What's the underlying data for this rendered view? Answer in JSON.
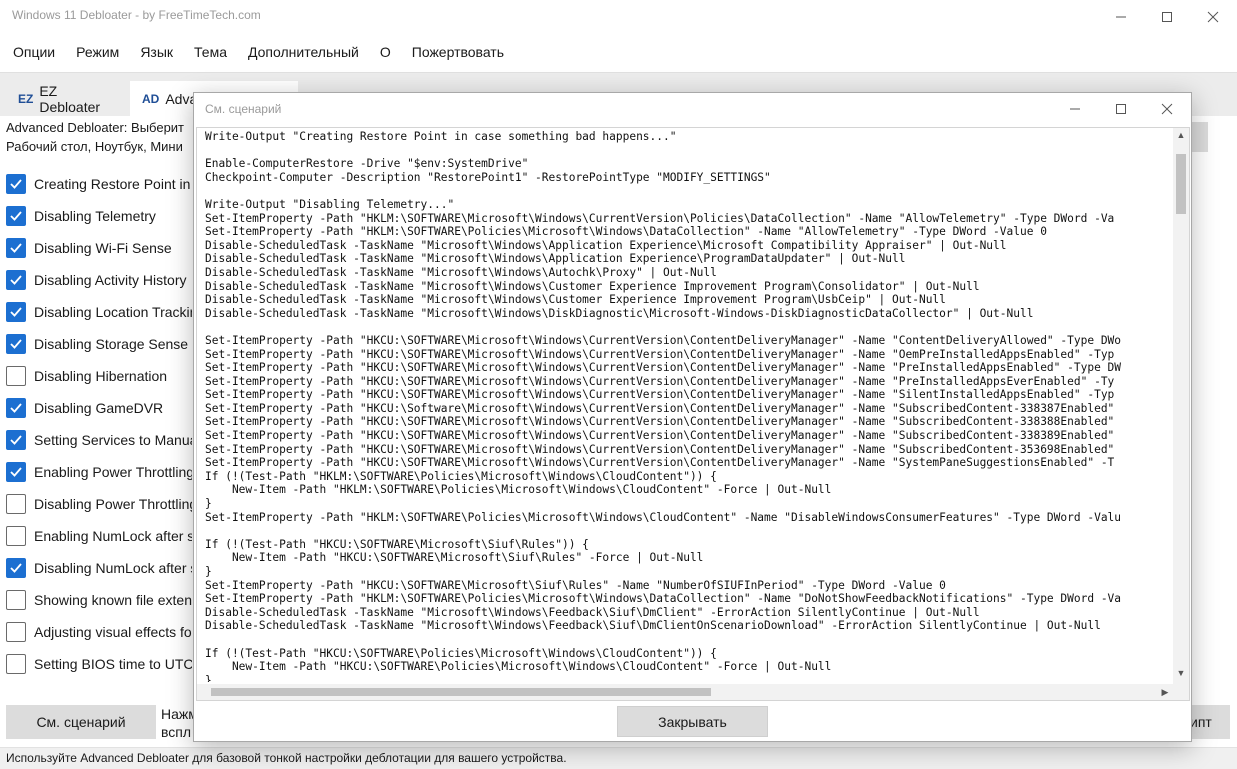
{
  "window": {
    "title": "Windows 11 Debloater - by FreeTimeTech.com"
  },
  "menu": [
    {
      "label": "Опции"
    },
    {
      "label": "Режим"
    },
    {
      "label": "Язык"
    },
    {
      "label": "Тема"
    },
    {
      "label": "Дополнительный"
    },
    {
      "label": "О"
    },
    {
      "label": "Пожертвовать"
    }
  ],
  "tabs": {
    "ez": {
      "abbr": "EZ",
      "label": "EZ Debloater"
    },
    "advanced": {
      "abbr": "AD",
      "label": "Adva"
    }
  },
  "description": {
    "line1": "Advanced Debloater: Выберит",
    "line2": "Рабочий стол, Ноутбук, Мини"
  },
  "options": [
    {
      "label": "Creating Restore Point in c",
      "checked": true
    },
    {
      "label": "Disabling Telemetry",
      "checked": true
    },
    {
      "label": "Disabling Wi-Fi Sense",
      "checked": true
    },
    {
      "label": "Disabling Activity History",
      "checked": true
    },
    {
      "label": "Disabling Location Tracking",
      "checked": true
    },
    {
      "label": "Disabling Storage Sense",
      "checked": true
    },
    {
      "label": "Disabling Hibernation",
      "checked": false
    },
    {
      "label": "Disabling GameDVR",
      "checked": true
    },
    {
      "label": "Setting Services to Manual",
      "checked": true
    },
    {
      "label": "Enabling Power Throttling",
      "checked": true
    },
    {
      "label": "Disabling Power Throttling",
      "checked": false
    },
    {
      "label": "Enabling NumLock after s",
      "checked": false
    },
    {
      "label": "Disabling NumLock after s",
      "checked": true
    },
    {
      "label": "Showing known file exten",
      "checked": false
    },
    {
      "label": "Adjusting visual effects fo",
      "checked": false
    },
    {
      "label": "Setting BIOS time to UTC",
      "checked": false
    }
  ],
  "bottom": {
    "view_script": "См. сценарий",
    "hint_line1": "Нажм",
    "hint_line2": "вспл",
    "right_button": "ипт"
  },
  "status": "Используйте Advanced Debloater для базовой тонкой настройки деблотации для вашего устройства.",
  "dialog": {
    "title": "См. сценарий",
    "close_button": "Закрывать",
    "script": "Write-Output \"Creating Restore Point in case something bad happens...\"\n\nEnable-ComputerRestore -Drive \"$env:SystemDrive\"\nCheckpoint-Computer -Description \"RestorePoint1\" -RestorePointType \"MODIFY_SETTINGS\"\n\nWrite-Output \"Disabling Telemetry...\"\nSet-ItemProperty -Path \"HKLM:\\SOFTWARE\\Microsoft\\Windows\\CurrentVersion\\Policies\\DataCollection\" -Name \"AllowTelemetry\" -Type DWord -Va\nSet-ItemProperty -Path \"HKLM:\\SOFTWARE\\Policies\\Microsoft\\Windows\\DataCollection\" -Name \"AllowTelemetry\" -Type DWord -Value 0\nDisable-ScheduledTask -TaskName \"Microsoft\\Windows\\Application Experience\\Microsoft Compatibility Appraiser\" | Out-Null\nDisable-ScheduledTask -TaskName \"Microsoft\\Windows\\Application Experience\\ProgramDataUpdater\" | Out-Null\nDisable-ScheduledTask -TaskName \"Microsoft\\Windows\\Autochk\\Proxy\" | Out-Null\nDisable-ScheduledTask -TaskName \"Microsoft\\Windows\\Customer Experience Improvement Program\\Consolidator\" | Out-Null\nDisable-ScheduledTask -TaskName \"Microsoft\\Windows\\Customer Experience Improvement Program\\UsbCeip\" | Out-Null\nDisable-ScheduledTask -TaskName \"Microsoft\\Windows\\DiskDiagnostic\\Microsoft-Windows-DiskDiagnosticDataCollector\" | Out-Null\n\nSet-ItemProperty -Path \"HKCU:\\SOFTWARE\\Microsoft\\Windows\\CurrentVersion\\ContentDeliveryManager\" -Name \"ContentDeliveryAllowed\" -Type DWo\nSet-ItemProperty -Path \"HKCU:\\SOFTWARE\\Microsoft\\Windows\\CurrentVersion\\ContentDeliveryManager\" -Name \"OemPreInstalledAppsEnabled\" -Typ\nSet-ItemProperty -Path \"HKCU:\\SOFTWARE\\Microsoft\\Windows\\CurrentVersion\\ContentDeliveryManager\" -Name \"PreInstalledAppsEnabled\" -Type DW\nSet-ItemProperty -Path \"HKCU:\\SOFTWARE\\Microsoft\\Windows\\CurrentVersion\\ContentDeliveryManager\" -Name \"PreInstalledAppsEverEnabled\" -Ty\nSet-ItemProperty -Path \"HKCU:\\SOFTWARE\\Microsoft\\Windows\\CurrentVersion\\ContentDeliveryManager\" -Name \"SilentInstalledAppsEnabled\" -Typ\nSet-ItemProperty -Path \"HKCU:\\Software\\Microsoft\\Windows\\CurrentVersion\\ContentDeliveryManager\" -Name \"SubscribedContent-338387Enabled\" \nSet-ItemProperty -Path \"HKCU:\\SOFTWARE\\Microsoft\\Windows\\CurrentVersion\\ContentDeliveryManager\" -Name \"SubscribedContent-338388Enabled\" \nSet-ItemProperty -Path \"HKCU:\\SOFTWARE\\Microsoft\\Windows\\CurrentVersion\\ContentDeliveryManager\" -Name \"SubscribedContent-338389Enabled\" \nSet-ItemProperty -Path \"HKCU:\\SOFTWARE\\Microsoft\\Windows\\CurrentVersion\\ContentDeliveryManager\" -Name \"SubscribedContent-353698Enabled\" \nSet-ItemProperty -Path \"HKCU:\\SOFTWARE\\Microsoft\\Windows\\CurrentVersion\\ContentDeliveryManager\" -Name \"SystemPaneSuggestionsEnabled\" -T\nIf (!(Test-Path \"HKLM:\\SOFTWARE\\Policies\\Microsoft\\Windows\\CloudContent\")) {\n    New-Item -Path \"HKLM:\\SOFTWARE\\Policies\\Microsoft\\Windows\\CloudContent\" -Force | Out-Null\n}\nSet-ItemProperty -Path \"HKLM:\\SOFTWARE\\Policies\\Microsoft\\Windows\\CloudContent\" -Name \"DisableWindowsConsumerFeatures\" -Type DWord -Valu\n\nIf (!(Test-Path \"HKCU:\\SOFTWARE\\Microsoft\\Siuf\\Rules\")) {\n    New-Item -Path \"HKCU:\\SOFTWARE\\Microsoft\\Siuf\\Rules\" -Force | Out-Null\n}\nSet-ItemProperty -Path \"HKCU:\\SOFTWARE\\Microsoft\\Siuf\\Rules\" -Name \"NumberOfSIUFInPeriod\" -Type DWord -Value 0\nSet-ItemProperty -Path \"HKLM:\\SOFTWARE\\Policies\\Microsoft\\Windows\\DataCollection\" -Name \"DoNotShowFeedbackNotifications\" -Type DWord -Va\nDisable-ScheduledTask -TaskName \"Microsoft\\Windows\\Feedback\\Siuf\\DmClient\" -ErrorAction SilentlyContinue | Out-Null\nDisable-ScheduledTask -TaskName \"Microsoft\\Windows\\Feedback\\Siuf\\DmClientOnScenarioDownload\" -ErrorAction SilentlyContinue | Out-Null\n\nIf (!(Test-Path \"HKCU:\\SOFTWARE\\Policies\\Microsoft\\Windows\\CloudContent\")) {\n    New-Item -Path \"HKCU:\\SOFTWARE\\Policies\\Microsoft\\Windows\\CloudContent\" -Force | Out-Null\n}"
  },
  "colors": {
    "accent": "#1c6fd1",
    "tab_abbr": "#1f4e96",
    "button_bg": "#dcdcdc"
  }
}
